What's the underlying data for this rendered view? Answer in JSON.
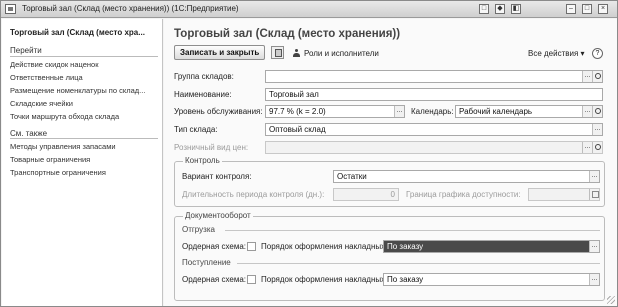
{
  "window": {
    "title": "Торговый зал (Склад (место хранения))  (1С:Предприятие)",
    "controls": [
      "□",
      "◆",
      "◧",
      "–",
      "□",
      "×"
    ]
  },
  "nav": {
    "title": "Торговый зал (Склад (место хра...",
    "goto_header": "Перейти",
    "goto_items": [
      "Действие скидок наценок",
      "Ответственные лица",
      "Размещение номенклатуры по склад...",
      "Складские ячейки",
      "Точки маршрута обхода склада"
    ],
    "see_also_header": "См. также",
    "see_also_items": [
      "Методы управления запасами",
      "Товарные ограничения",
      "Транспортные ограничения"
    ]
  },
  "form": {
    "title": "Торговый зал (Склад (место хранения))",
    "toolbar": {
      "save_close": "Записать и закрыть",
      "roles": "Роли и исполнители",
      "all_actions": "Все действия ▾",
      "help": "?"
    },
    "fields": {
      "group_label": "Группа складов:",
      "group_value": "",
      "name_label": "Наименование:",
      "name_value": "Торговый зал",
      "service_label": "Уровень обслуживания:",
      "service_value": "97.7 % (k = 2.0)",
      "calendar_label": "Календарь:",
      "calendar_value": "Рабочий календарь",
      "type_label": "Тип склада:",
      "type_value": "Оптовый склад",
      "price_label": "Розничный вид цен:",
      "price_value": ""
    },
    "control": {
      "title": "Контроль",
      "variant_label": "Вариант контроля:",
      "variant_value": "Остатки",
      "period_label": "Длительность периода контроля (дн.):",
      "period_value": "0",
      "border_label": "Граница графика доступности:",
      "border_value": ""
    },
    "docflow": {
      "title": "Документооборот",
      "shipment_head": "Отгрузка",
      "shipment_order_label": "Ордерная схема:",
      "shipment_proc_label": "Порядок оформления накладных:",
      "shipment_proc_value": "По заказу",
      "receipt_head": "Поступление",
      "receipt_order_label": "Ордерная схема:",
      "receipt_proc_label": "Порядок оформления накладных:",
      "receipt_proc_value": "По заказу"
    }
  }
}
